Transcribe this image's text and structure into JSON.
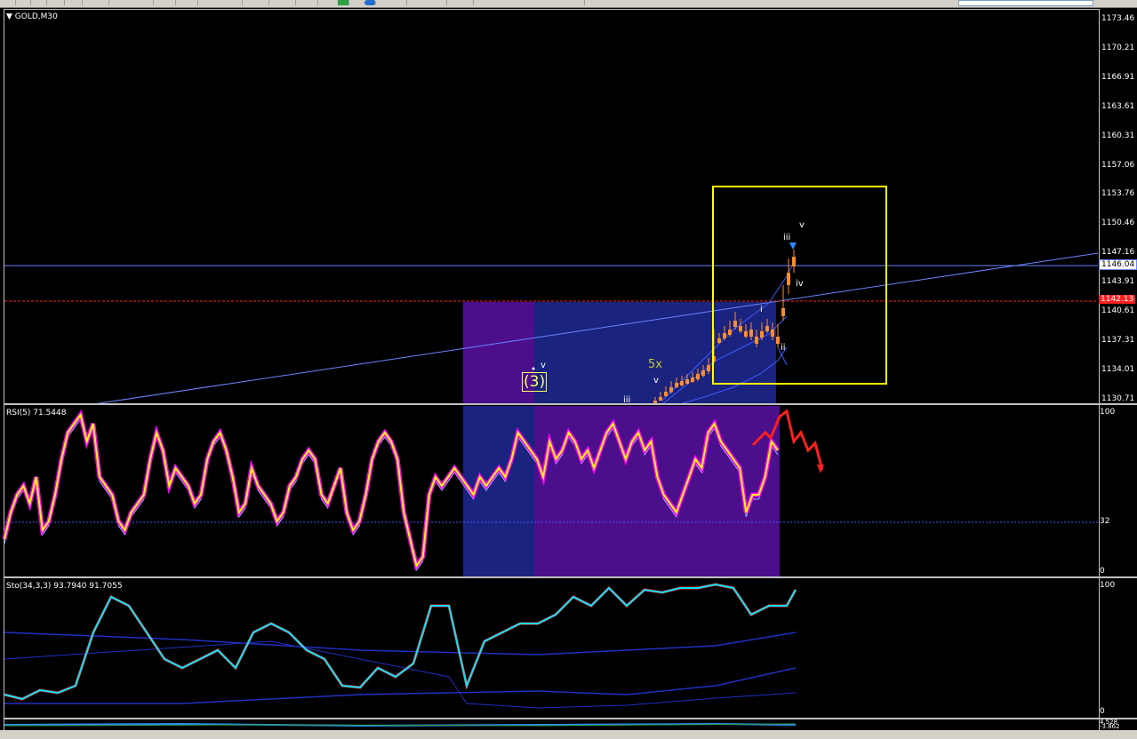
{
  "toolbar": {
    "items": [
      "new-chart",
      "open",
      "save",
      "print",
      "zoom-in",
      "zoom-out",
      "tile",
      "scroll",
      "autoscroll",
      "crosshair",
      "indicator",
      "period",
      "template"
    ]
  },
  "main_chart": {
    "title": "GOLD,M30",
    "price_labels": [
      "1173.46",
      "1170.21",
      "1166.91",
      "1163.61",
      "1160.31",
      "1157.06",
      "1153.76",
      "1150.46",
      "1147.16",
      "1143.91",
      "1140.61",
      "1137.31",
      "1134.01",
      "1130.71"
    ],
    "current_price": "1146.04",
    "bid_price": "1142.13",
    "wave_labels": {
      "five_x": "5x",
      "three": "(3)",
      "v_top": "v",
      "v_small": "v",
      "iii_top": "iii",
      "iv": "iv",
      "i": "i",
      "ii": "ii",
      "iii_bottom": "iii"
    }
  },
  "rsi_pane": {
    "title": "RSI(5) 71.5448",
    "levels": [
      "100",
      "32",
      "0"
    ]
  },
  "sto_pane": {
    "title": "Sto(34,3,3) 93.7940 91.7055",
    "levels": [
      "100",
      "0"
    ]
  },
  "bottom_pane": {
    "levels": [
      "4.528",
      "-3.862"
    ]
  },
  "colors": {
    "price_line": "#6a85ff",
    "bid_line": "#ff2020",
    "box": "#ffff00",
    "rsi": "#ffff00",
    "rsi_glow": "#ff00ff",
    "sto_main": "#00e5ff",
    "sto_signal": "#ff2020",
    "purple": "#4b0f8c",
    "navy": "#1a237e"
  }
}
